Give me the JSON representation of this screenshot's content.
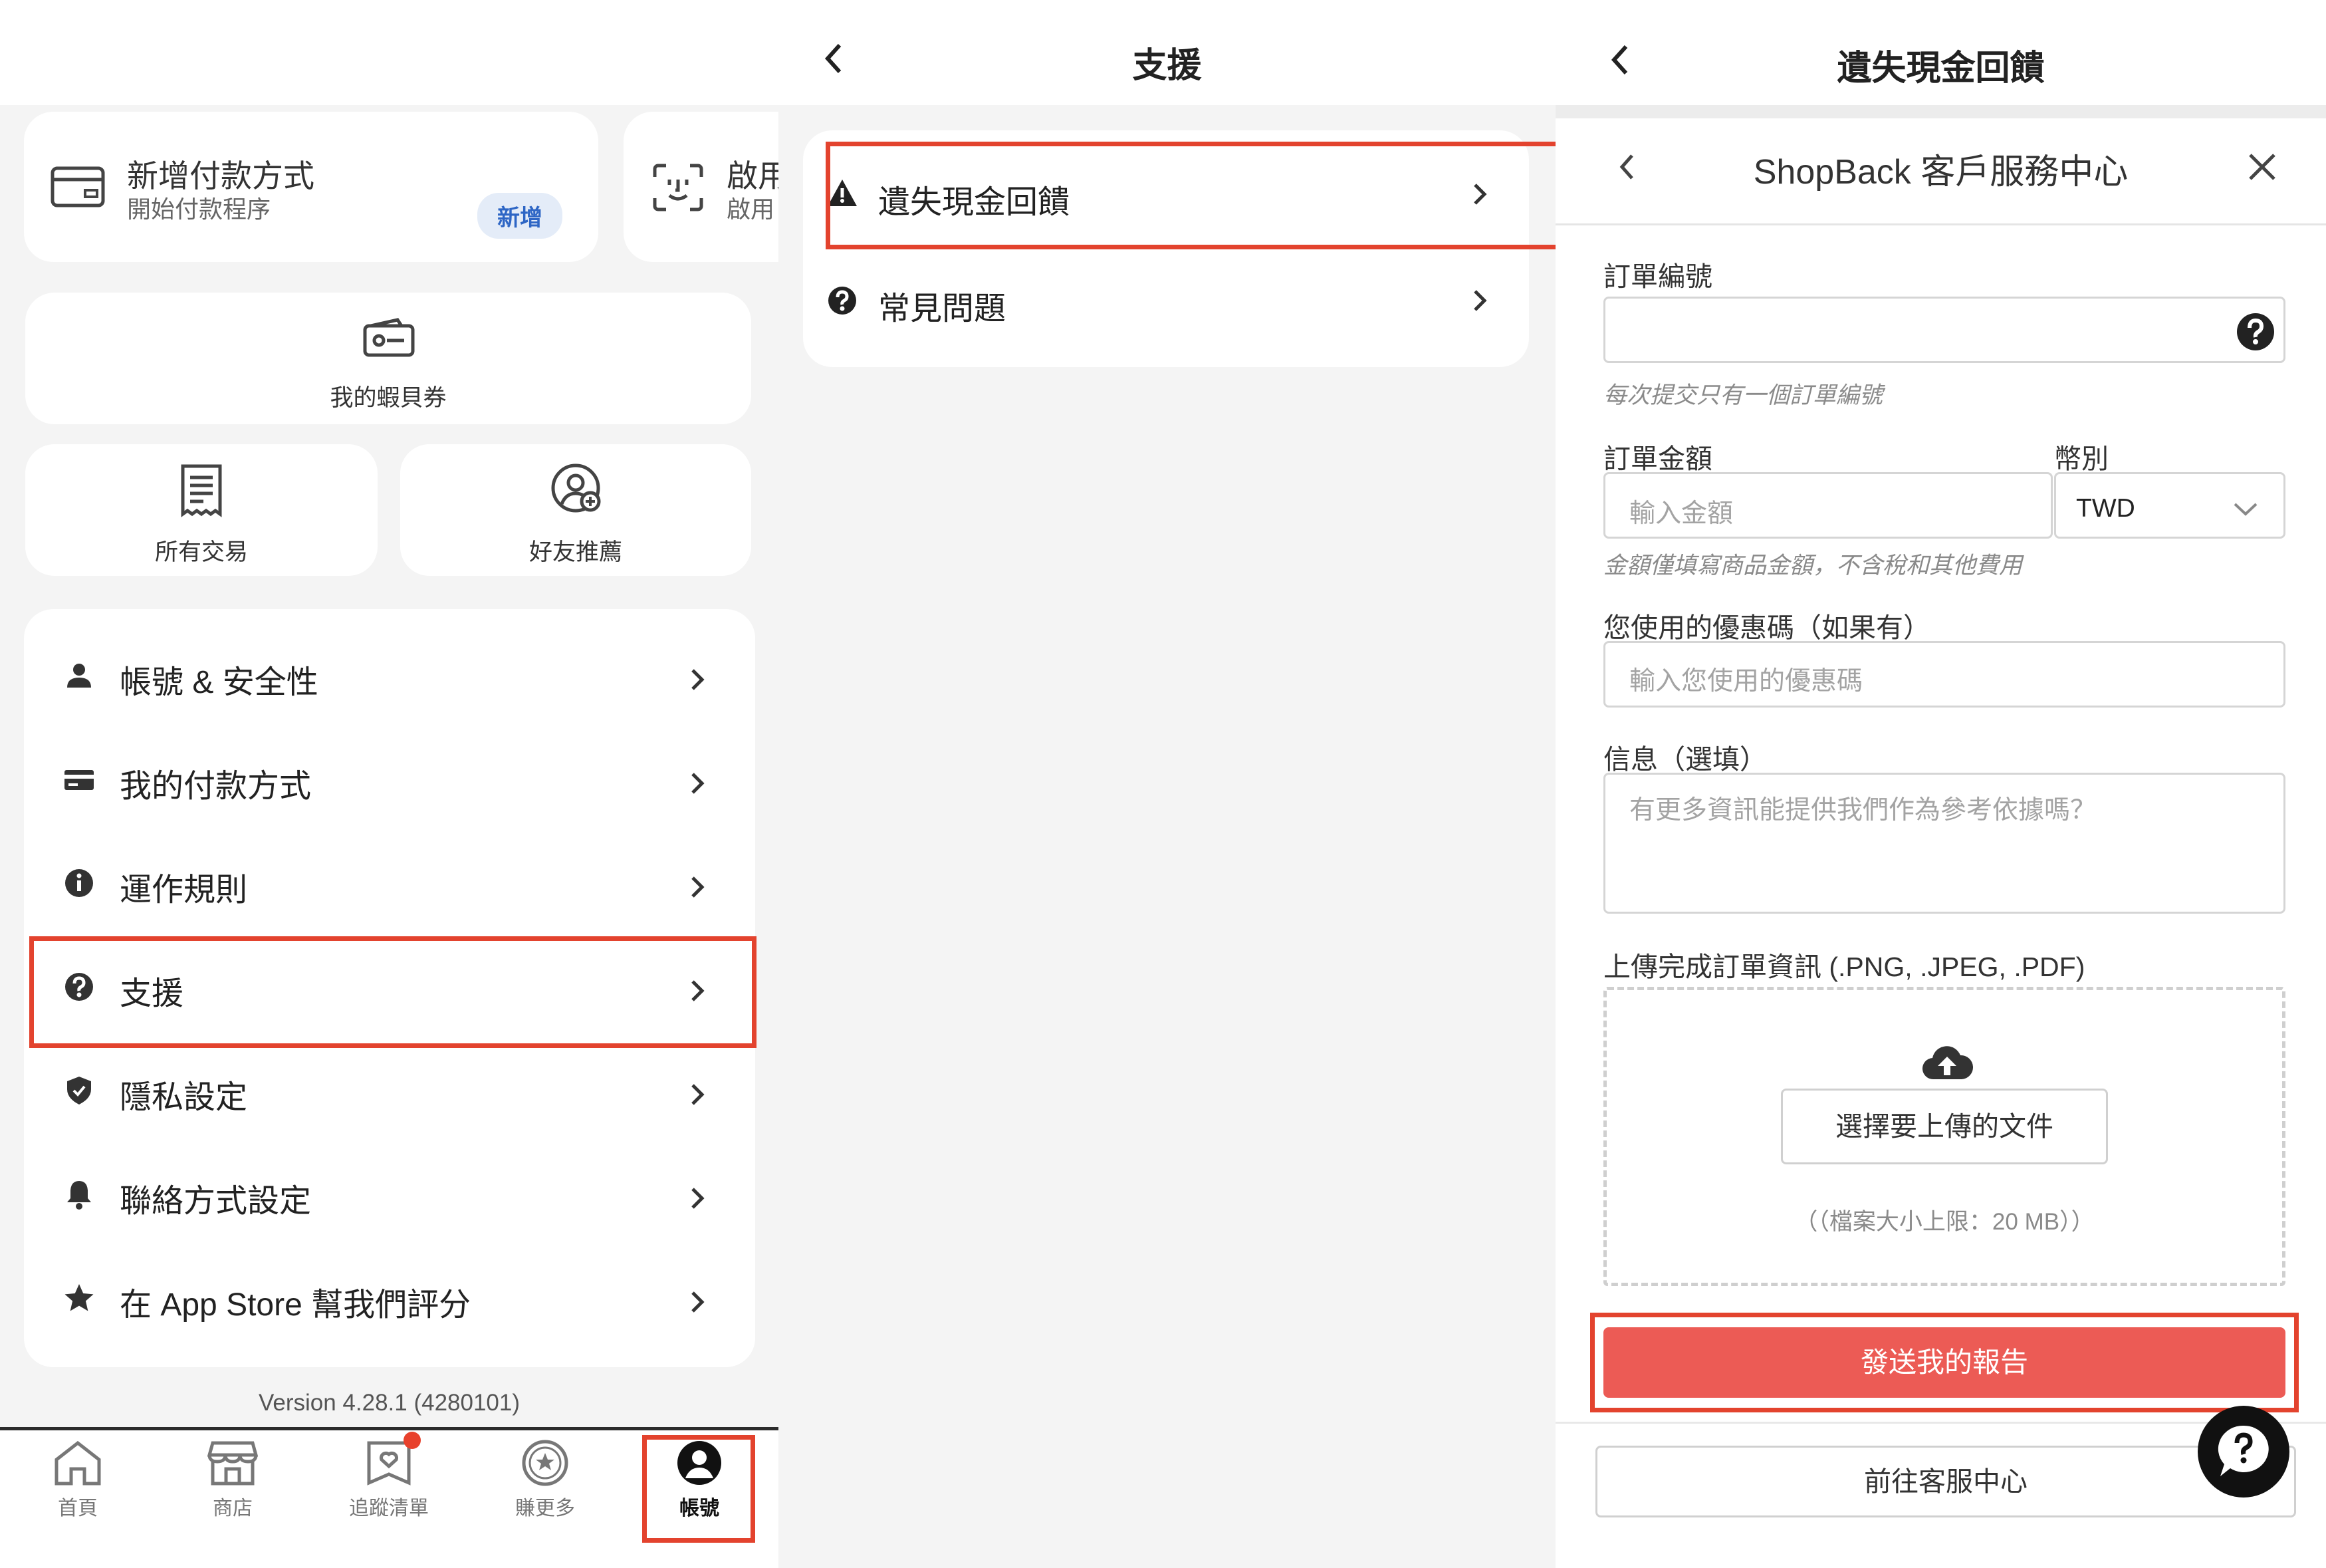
{
  "account_panel": {
    "payment_card": {
      "title": "新增付款方式",
      "subtitle": "開始付款程序",
      "badge": "新增"
    },
    "faceid_card": {
      "title": "啟用",
      "subtitle": "啟用"
    },
    "tiles": {
      "vouchers": "我的蝦貝券",
      "transactions": "所有交易",
      "referral": "好友推薦"
    },
    "menu": [
      {
        "label": "帳號 & 安全性",
        "icon": "person-icon"
      },
      {
        "label": "我的付款方式",
        "icon": "card-icon"
      },
      {
        "label": "運作規則",
        "icon": "info-icon"
      },
      {
        "label": "支援",
        "icon": "help-icon",
        "highlighted": true
      },
      {
        "label": "隱私設定",
        "icon": "shield-icon"
      },
      {
        "label": "聯絡方式設定",
        "icon": "bell-icon"
      },
      {
        "label": "在 App Store 幫我們評分",
        "icon": "star-icon"
      }
    ],
    "version": "Version 4.28.1 (4280101)",
    "tabs": [
      {
        "label": "首頁",
        "icon": "home-icon"
      },
      {
        "label": "商店",
        "icon": "store-icon"
      },
      {
        "label": "追蹤清單",
        "icon": "watchlist-icon"
      },
      {
        "label": "賺更多",
        "icon": "earn-icon"
      },
      {
        "label": "帳號",
        "icon": "account-icon",
        "active": true
      }
    ]
  },
  "support_panel": {
    "title": "支援",
    "items": [
      {
        "label": "遺失現金回饋",
        "icon": "warning-icon",
        "highlighted": true
      },
      {
        "label": "常見問題",
        "icon": "help-icon"
      }
    ]
  },
  "claim_panel": {
    "title": "遺失現金回饋",
    "sheet_title": "ShopBack 客戶服務中心",
    "order_id": {
      "label": "訂單編號",
      "value": "",
      "hint": "每次提交只有一個訂單編號"
    },
    "amount": {
      "label": "訂單金額",
      "placeholder": "輸入金額",
      "hint": "金額僅填寫商品金額，不含稅和其他費用"
    },
    "currency": {
      "label": "幣別",
      "selected": "TWD"
    },
    "coupon": {
      "label": "您使用的優惠碼（如果有）",
      "placeholder": "輸入您使用的優惠碼"
    },
    "message": {
      "label": "信息（選填）",
      "placeholder": "有更多資訊能提供我們作為參考依據嗎？"
    },
    "upload": {
      "label": "上傳完成訂單資訊 (.PNG, .JPEG, .PDF)",
      "button": "選擇要上傳的文件",
      "limit": "（（檔案大小上限：20 MB））"
    },
    "submit": "發送我的報告",
    "help_center": "前往客服中心"
  },
  "colors": {
    "highlight": "#e3432e",
    "submit": "#ec5b55",
    "badge_text": "#2e66c5",
    "notification_dot": "#e8412c"
  }
}
